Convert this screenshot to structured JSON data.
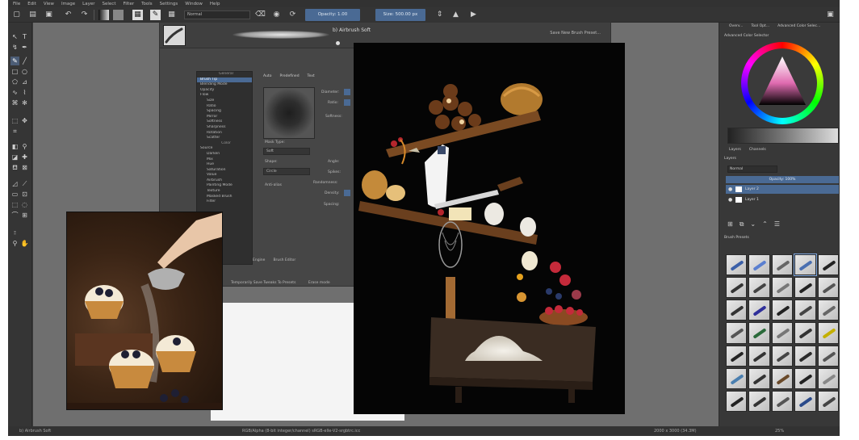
{
  "menu": [
    "File",
    "Edit",
    "View",
    "Image",
    "Layer",
    "Select",
    "Filter",
    "Tools",
    "Settings",
    "Window",
    "Help"
  ],
  "toolbar": {
    "blend_mode": "Normal",
    "opacity_label": "Opacity: 1.00",
    "size_label": "Size: 500.00 px"
  },
  "brush_editor": {
    "title": "b) Airbrush Soft",
    "save_label": "Save New Brush Preset...",
    "options_header": "General",
    "options": [
      "Brush Tip",
      "Blending Mode",
      "Opacity",
      "Flow",
      "Size",
      "Ratio",
      "Spacing",
      "Mirror",
      "Softness",
      "Sharpness",
      "Rotation",
      "Scatter",
      "Color",
      "Source",
      "Darken",
      "Mix",
      "Hue",
      "Saturation",
      "Value",
      "Airbrush",
      "Painting Mode",
      "Texture",
      "Masked Brush",
      "Filter"
    ],
    "tabs": [
      "Auto",
      "Predefined",
      "Text"
    ],
    "fields": {
      "diameter": "Diameter:",
      "ratio": "Ratio:",
      "softness": "Softness:",
      "mask_type": "Mask Type:",
      "mask_type_value": "Soft",
      "shape": "Shape:",
      "shape_value": "Circle",
      "angle": "Angle:",
      "spikes": "Spikes:",
      "randomness": "Randomness:",
      "density": "Density:",
      "spacing": "Spacing:",
      "anti_alias": "Anti-alias"
    },
    "bottom_tabs": [
      "Engine",
      "Brush Editor"
    ],
    "bottom_check": "Temporarily Save Tweaks To Presets",
    "bottom_check2": "Erase mode"
  },
  "dock": {
    "tabs": [
      "Overv...",
      "Tool Opt...",
      "Advanced Color Selec..."
    ],
    "color_selector_title": "Advanced Color Selector",
    "layers_tabs": [
      "Layers",
      "Channels"
    ],
    "layers_title": "Layers",
    "layer_mode": "Normal",
    "layer_opacity": "Opacity: 100%",
    "layers": [
      {
        "name": "Layer 2",
        "selected": true
      },
      {
        "name": "Layer 1",
        "selected": false
      }
    ],
    "presets_title": "Brush Presets",
    "preset_colors": [
      "#3a5fa8",
      "#5a7fd0",
      "#666",
      "#4a6fb0",
      "#222",
      "#333",
      "#444",
      "#777",
      "#222",
      "#555",
      "#333",
      "#2f2f9a",
      "#222",
      "#444",
      "#666",
      "#555",
      "#2a6a3a",
      "#777",
      "#333",
      "#c4b000",
      "#222",
      "#333",
      "#444",
      "#2a2a2a",
      "#555",
      "#4a7fb0",
      "#333",
      "#6a4a2a",
      "#222",
      "#888",
      "#222",
      "#333",
      "#555",
      "#2a4a8a",
      "#444"
    ]
  },
  "status": {
    "brush": "b) Airbrush Soft",
    "color_info": "RGB/Alpha (8-bit integer/channel)  sRGB-elle-V2-srgbtrc.icc",
    "dims": "2000 x 3000 (34.3M)",
    "zoom": "25%"
  }
}
